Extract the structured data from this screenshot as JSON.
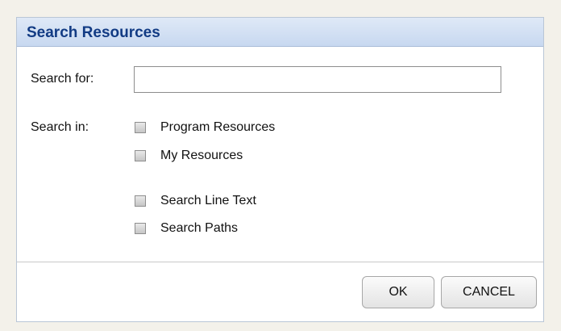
{
  "dialog": {
    "title": "Search Resources",
    "search_for_label": "Search for:",
    "search_value": "",
    "search_in_label": "Search in:",
    "options": [
      {
        "label": "Program Resources",
        "checked": false
      },
      {
        "label": "My Resources",
        "checked": false
      },
      {
        "label": "Search Line Text",
        "checked": false
      },
      {
        "label": "Search Paths",
        "checked": false
      }
    ],
    "ok_label": "OK",
    "cancel_label": "CANCEL"
  },
  "colors": {
    "title_text": "#123b84",
    "titlebar_top": "#dfe9f7",
    "titlebar_bottom": "#c7d8f0",
    "background": "#f3f1ea"
  }
}
